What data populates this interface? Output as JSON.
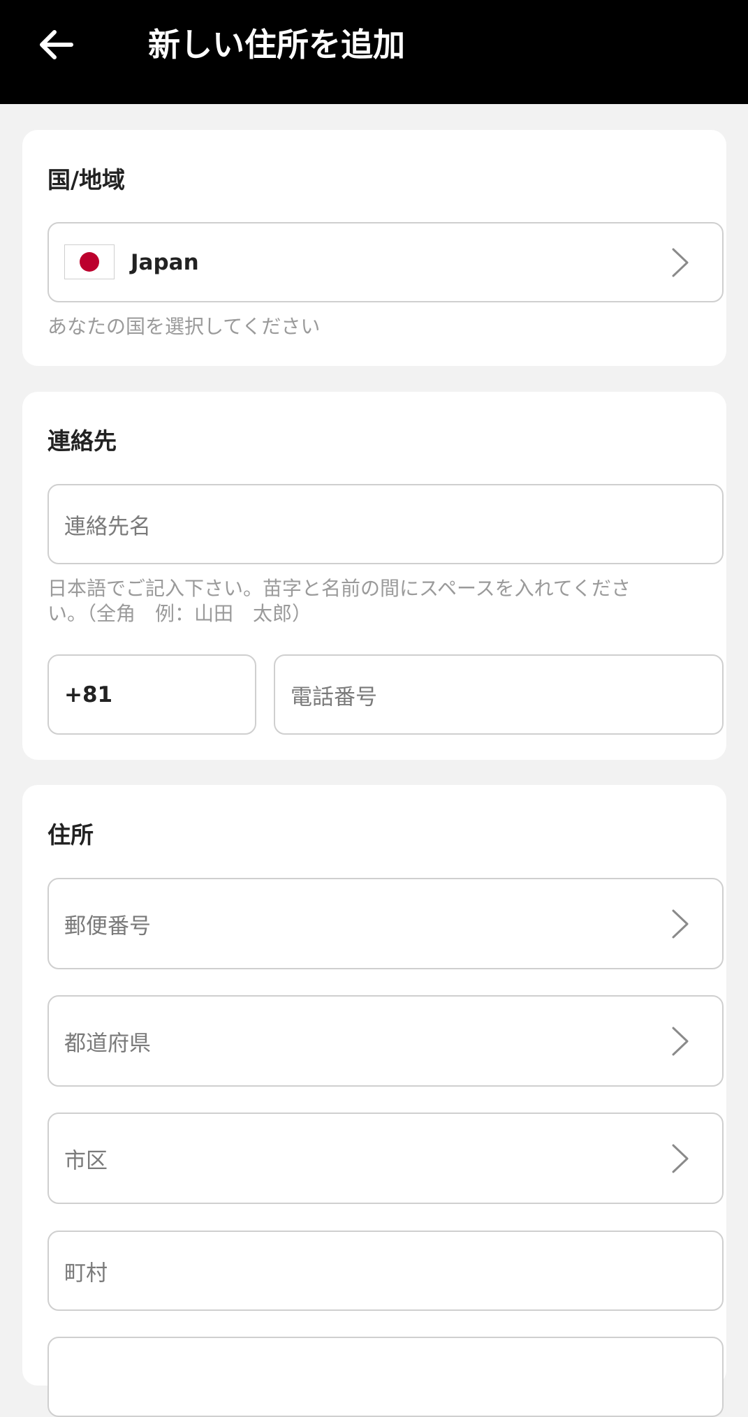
{
  "header": {
    "title": "新しい住所を追加",
    "back_icon": "arrow-left-icon"
  },
  "country_section": {
    "title": "国/地域",
    "selected_country": "Japan",
    "flag_icon": "japan-flag-icon",
    "hint": "あなたの国を選択してください"
  },
  "contact_section": {
    "title": "連絡先",
    "name_placeholder": "連絡先名",
    "name_hint_line1": "日本語でご記入下さい。苗字と名前の間にスペースを入れてくださ",
    "name_hint_line2": "い。（全角　例：山田　太郎）",
    "country_code": "+81",
    "phone_placeholder": "電話番号"
  },
  "address_section": {
    "title": "住所",
    "postal_code_placeholder": "郵便番号",
    "prefecture_placeholder": "都道府県",
    "city_placeholder": "市区",
    "town_placeholder": "町村"
  },
  "colors": {
    "header_bg": "#000000",
    "page_bg": "#f2f2f2",
    "flag_red": "#bc002d"
  }
}
